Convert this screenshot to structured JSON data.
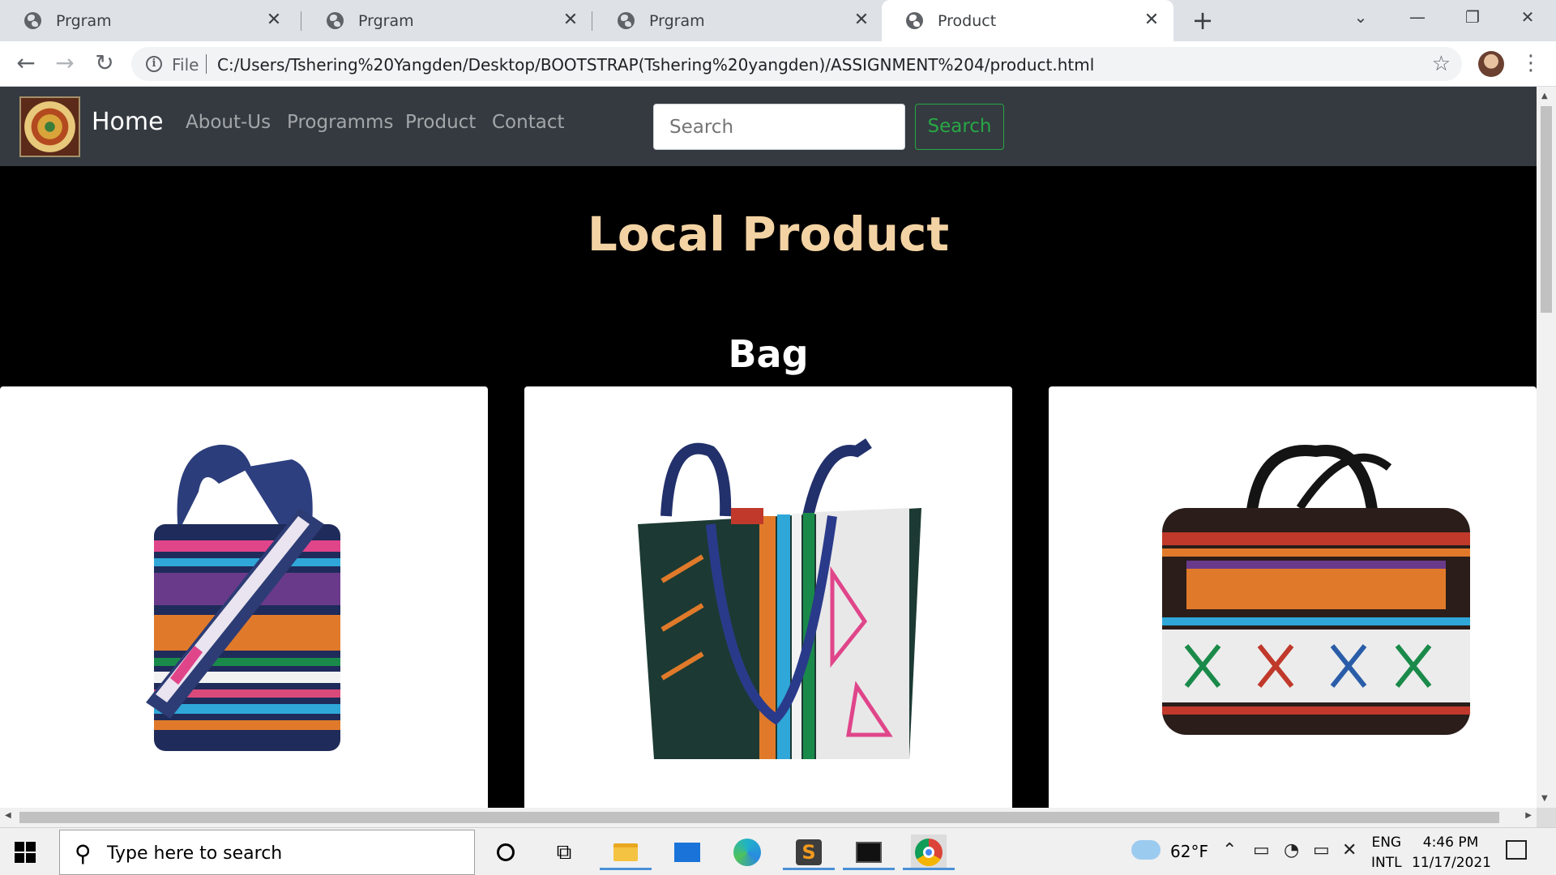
{
  "browser": {
    "tabs": [
      {
        "title": "Prgram",
        "active": false
      },
      {
        "title": "Prgram",
        "active": false
      },
      {
        "title": "Prgram",
        "active": false
      },
      {
        "title": "Product",
        "active": true
      }
    ],
    "new_tab_symbol": "+",
    "address": {
      "scheme_label": "File",
      "url": "C:/Users/Tshering%20Yangden/Desktop/BOOTSTRAP(Tshering%20yangden)/ASSIGNMENT%204/product.html"
    }
  },
  "site": {
    "brand": "Home",
    "nav_links": [
      "About-Us",
      "Programms",
      "Product",
      "Contact"
    ],
    "search": {
      "placeholder": "Search",
      "button_label": "Search"
    },
    "page_title": "Local Product",
    "section_title": "Bag",
    "colors": {
      "navbar": "#343a40",
      "heading": "#f3d3a3",
      "search_button": "#28a745",
      "page_bg": "#000000"
    },
    "products": [
      {
        "name": "sling-bag"
      },
      {
        "name": "tote-bag"
      },
      {
        "name": "laptop-bag"
      }
    ]
  },
  "taskbar": {
    "search_placeholder": "Type here to search",
    "weather": "62°F",
    "language": {
      "line1": "ENG",
      "line2": "INTL"
    },
    "clock": {
      "time": "4:46 PM",
      "date": "11/17/2021"
    },
    "apps": [
      "cortana-icon",
      "task-view-icon",
      "file-explorer-icon",
      "mail-icon",
      "edge-icon",
      "sublime-text-icon",
      "terminal-icon",
      "chrome-icon"
    ]
  }
}
